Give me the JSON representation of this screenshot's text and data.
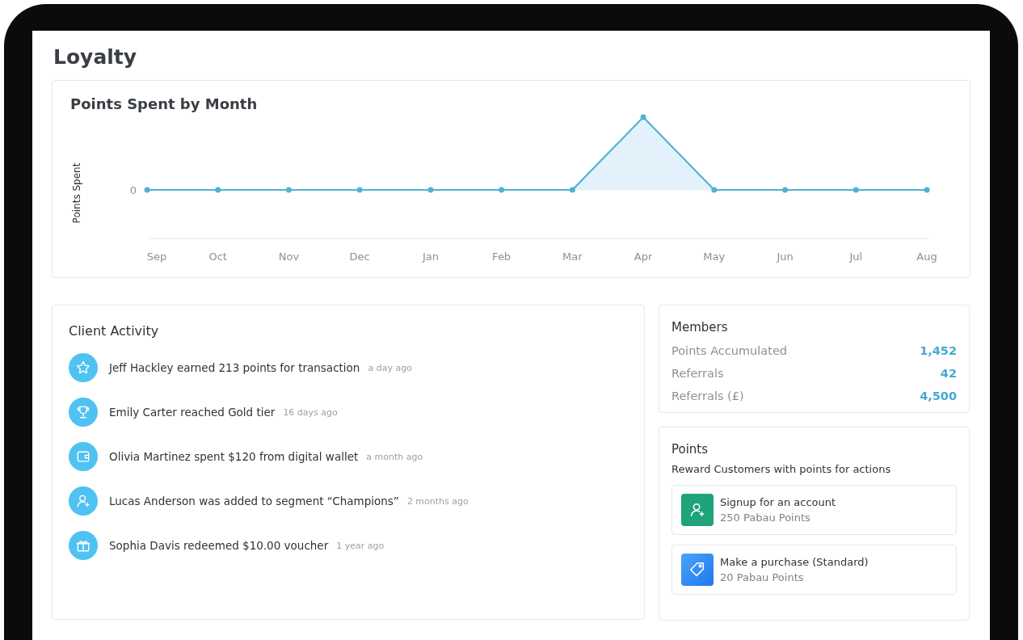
{
  "page": {
    "title": "Loyalty"
  },
  "chart": {
    "title": "Points Spent by Month",
    "ylabel": "Points Spent",
    "ytick": "0",
    "months": [
      "Sep",
      "Oct",
      "Nov",
      "Dec",
      "Jan",
      "Feb",
      "Mar",
      "Apr",
      "May",
      "Jun",
      "Jul",
      "Aug"
    ]
  },
  "client_activity": {
    "title": "Client Activity",
    "items": [
      {
        "kind": "star",
        "text": "Jeff Hackley earned 213 points for transaction",
        "time": "a day ago"
      },
      {
        "kind": "trophy",
        "text": "Emily Carter reached Gold tier",
        "time": "16 days ago"
      },
      {
        "kind": "wallet",
        "text": "Olivia Martinez spent $120 from digital wallet",
        "time": "a month ago"
      },
      {
        "kind": "user",
        "text": "Lucas Anderson was added to segment “Champions”",
        "time": "2 months ago"
      },
      {
        "kind": "gift",
        "text": "Sophia Davis redeemed $10.00 voucher",
        "time": "1 year ago"
      }
    ]
  },
  "members": {
    "title": "Members",
    "stats": [
      {
        "label": "Points Accumulated",
        "value": "1,452"
      },
      {
        "label": "Referrals",
        "value": "42"
      },
      {
        "label": "Referrals (£)",
        "value": "4,500"
      }
    ]
  },
  "points": {
    "title": "Points",
    "subtitle": "Reward Customers with points for actions",
    "actions": [
      {
        "kind": "user",
        "title": "Signup for an account",
        "points": "250 Pabau Points"
      },
      {
        "kind": "tag",
        "title": "Make a purchase (Standard)",
        "points": "20 Pabau Points"
      }
    ]
  }
}
